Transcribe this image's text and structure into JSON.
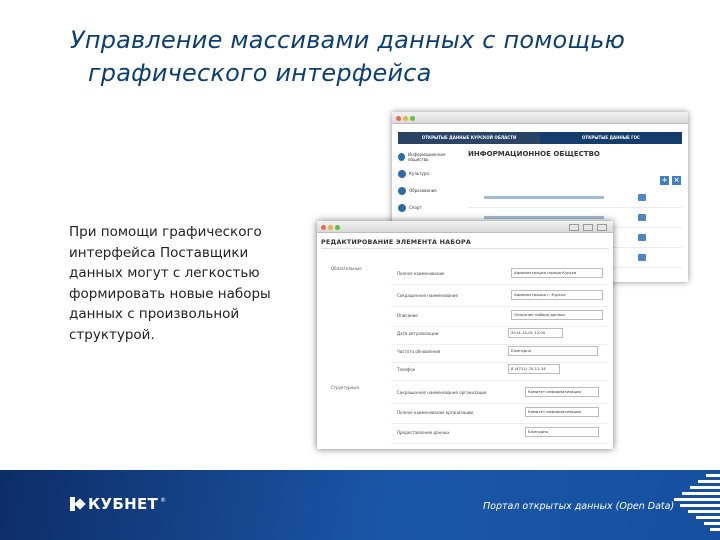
{
  "slide": {
    "title_line1": "Управление массивами данных с помощью",
    "title_line2": "графического интерфейса",
    "body": "При помощи графического интерфейса Поставщики данных могут с легкостью формировать новые наборы данных с произвольной структурой."
  },
  "back_window": {
    "tabs": [
      "ОТКРЫТЫЕ ДАННЫЕ КУРСКОЙ ОБЛАСТИ",
      "ОТКРЫТЫЕ ДАННЫЕ ГОС"
    ],
    "main_heading": "ИНФОРМАЦИОННОЕ ОБЩЕСТВО",
    "sidebar_items": [
      "Информационное общество",
      "Культура",
      "Образование",
      "Спорт",
      "ЖКХ"
    ],
    "add_icon": "plus-icon",
    "delete_icon": "close-icon"
  },
  "front_window": {
    "heading": "РЕДАКТИРОВАНИЕ ЭЛЕМЕНТА НАБОРА",
    "section1": "Обязательные",
    "section2": "Структурные",
    "fields": [
      {
        "label": "Полное наименование",
        "value": "Администрация города Курска"
      },
      {
        "label": "Сокращенное наименование",
        "value": "Администрация г. Курска"
      },
      {
        "label": "Описание",
        "value": "Описание набора данных"
      },
      {
        "label": "Дата актуализации",
        "value": "2014-10-01 12:00"
      },
      {
        "label": "Частота обновления",
        "value": "Ежегодно"
      },
      {
        "label": "Телефон",
        "value": "8 (4712) 70-12-34"
      },
      {
        "label": "Сокращенное наименование организации",
        "value": "Комитет информатизации"
      },
      {
        "label": "Полное наименование организации",
        "value": "Комитет информатизации"
      },
      {
        "label": "Предоставление данных",
        "value": "Ежегодно"
      }
    ]
  },
  "banner": {
    "logo_text": "КУБНЕТ",
    "logo_tm": "®",
    "portal_text": "Портал открытых данных (Open Data)",
    "background_color": "#1b57a8"
  }
}
